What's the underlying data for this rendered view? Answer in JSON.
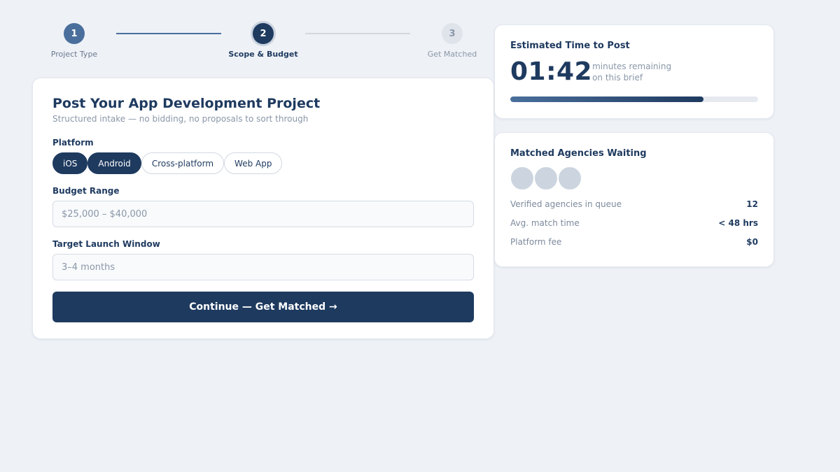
{
  "stepper": {
    "steps": [
      {
        "number": "1",
        "label": "Project Type",
        "state": "done"
      },
      {
        "number": "2",
        "label": "Scope & Budget",
        "state": "active"
      },
      {
        "number": "3",
        "label": "Get Matched",
        "state": "todo"
      }
    ]
  },
  "form": {
    "title": "Post Your App Development Project",
    "subtitle": "Structured intake — no bidding, no proposals to sort through",
    "platform": {
      "label": "Platform",
      "options": [
        {
          "label": "iOS",
          "selected": true
        },
        {
          "label": "Android",
          "selected": true
        },
        {
          "label": "Cross-platform",
          "selected": false
        },
        {
          "label": "Web App",
          "selected": false
        }
      ]
    },
    "budget": {
      "label": "Budget Range",
      "value": "",
      "placeholder": "$25,000 – $40,000"
    },
    "launch": {
      "label": "Target Launch Window",
      "value": "",
      "placeholder": "3–4 months"
    },
    "submit_label": "Continue — Get Matched →"
  },
  "timer": {
    "title": "Estimated Time to Post",
    "value": "01:42",
    "note_line1": "minutes remaining",
    "note_line2": "on this brief",
    "progress_percent": 78
  },
  "agencies": {
    "title": "Matched Agencies Waiting",
    "avatar_count": 3,
    "stats": [
      {
        "label": "Verified agencies in queue",
        "value": "12"
      },
      {
        "label": "Avg. match time",
        "value": "< 48 hrs"
      },
      {
        "label": "Platform fee",
        "value": "$0"
      }
    ]
  },
  "colors": {
    "primary": "#1e3a5f",
    "accent": "#4a6f9c",
    "background": "#eef1f6",
    "muted_text": "#8a97a8"
  }
}
